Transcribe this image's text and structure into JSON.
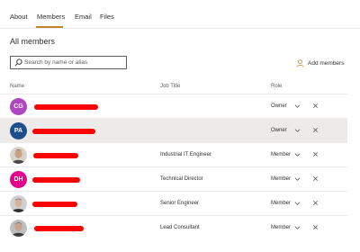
{
  "tabs": [
    {
      "label": "About"
    },
    {
      "label": "Members"
    },
    {
      "label": "Email"
    },
    {
      "label": "Files"
    }
  ],
  "section_title": "All members",
  "search": {
    "placeholder": "Search by name or alias"
  },
  "add_members_label": "Add members",
  "columns": {
    "name": "Name",
    "job_title": "Job Title",
    "role": "Role"
  },
  "members": [
    {
      "initials": "CG",
      "avatar_color": "#b146c2",
      "job_title": "",
      "role": "Owner"
    },
    {
      "initials": "PA",
      "avatar_color": "#1f4e8c",
      "job_title": "",
      "role": "Owner"
    },
    {
      "initials": "",
      "avatar_icon": "person-photo",
      "job_title": "Industrial IT Engineer",
      "role": "Member"
    },
    {
      "initials": "DH",
      "avatar_color": "#e3008c",
      "job_title": "Technical Director",
      "role": "Member"
    },
    {
      "initials": "",
      "avatar_icon": "person-photo",
      "job_title": "Senior Engineer",
      "role": "Member"
    },
    {
      "initials": "",
      "avatar_icon": "person-photo",
      "job_title": "Lead Consultant",
      "role": "Member"
    }
  ]
}
